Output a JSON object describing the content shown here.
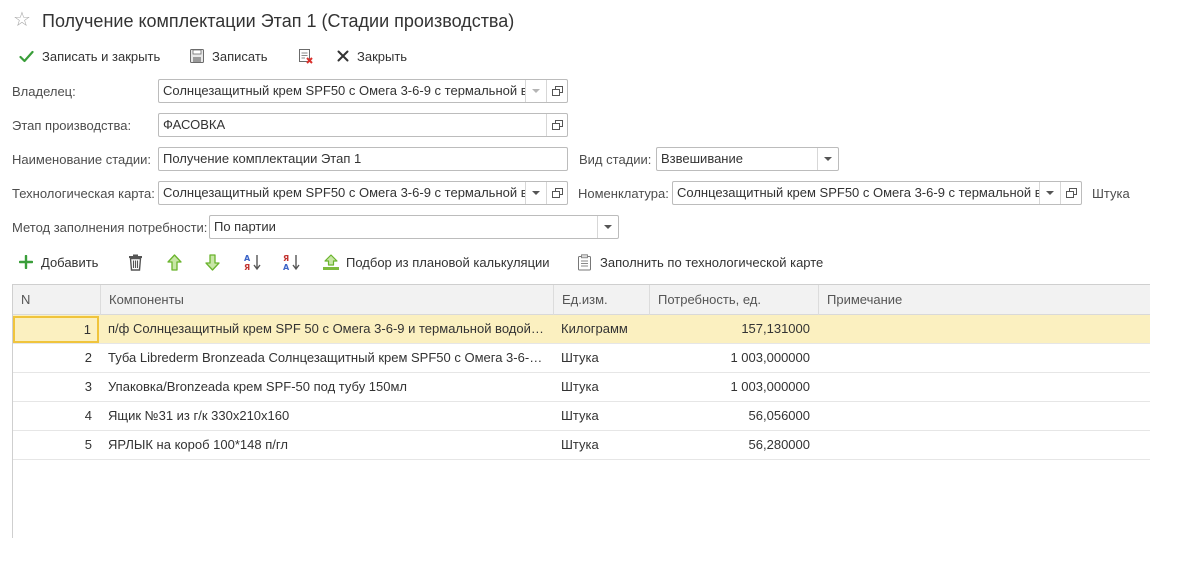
{
  "window": {
    "title": "Получение комплектации Этап 1 (Стадии производства)"
  },
  "toolbar": {
    "save_close_label": "Записать и закрыть",
    "save_label": "Записать",
    "close_label": "Закрыть"
  },
  "form": {
    "owner_label": "Владелец:",
    "owner_value": "Солнцезащитный крем SPF50 с Омега 3-6-9 с термальной в",
    "stage_label": "Этап производства:",
    "stage_value": "ФАСОВКА",
    "stage_name_label": "Наименование стадии:",
    "stage_name_value": "Получение комплектации Этап 1",
    "stage_kind_label": "Вид стадии:",
    "stage_kind_value": "Взвешивание",
    "tech_card_label": "Технологическая карта:",
    "tech_card_value": "Солнцезащитный крем SPF50 с Омега 3-6-9 с термальной в",
    "nomenclature_label": "Номенклатура:",
    "nomenclature_value": "Солнцезащитный крем SPF50 с Омега 3-6-9 с термальной в",
    "unit_value": "Штука",
    "fill_method_label": "Метод заполнения потребности:",
    "fill_method_value": "По партии"
  },
  "table_toolbar": {
    "add_label": "Добавить",
    "pick_plan_label": "Подбор из плановой калькуляции",
    "fill_tech_label": "Заполнить по технологической карте"
  },
  "table": {
    "columns": [
      "N",
      "Компоненты",
      "Ед.изм.",
      "Потребность, ед.",
      "Примечание"
    ],
    "rows": [
      {
        "n": "1",
        "component": "п/ф Солнцезащитный крем SPF 50 с Омега 3-6-9 и термальной водой и ...",
        "unit": "Килограмм",
        "need": "157,131000",
        "note": ""
      },
      {
        "n": "2",
        "component": "Туба Librederm Bronzeada Солнцезащитный крем SPF50 с Омега 3-6-9 ...",
        "unit": "Штука",
        "need": "1 003,000000",
        "note": ""
      },
      {
        "n": "3",
        "component": "Упаковка/Bronzeada крем SPF-50 под тубу 150мл",
        "unit": "Штука",
        "need": "1 003,000000",
        "note": ""
      },
      {
        "n": "4",
        "component": "Ящик №31 из г/к  330х210х160",
        "unit": "Штука",
        "need": "56,056000",
        "note": ""
      },
      {
        "n": "5",
        "component": "ЯРЛЫК на короб  100*148 п/гл",
        "unit": "Штука",
        "need": "56,280000",
        "note": ""
      }
    ],
    "selected_row": 0
  },
  "colors": {
    "selected_row_bg": "#fbf0c0",
    "selected_cell_border": "#f0c43c",
    "header_bg": "#f2f2f2",
    "save_check": "#3a9e3a",
    "add_plus": "#3a9e3a",
    "arrow_green": "#6ab42d",
    "delete_x": "#d9302c"
  }
}
